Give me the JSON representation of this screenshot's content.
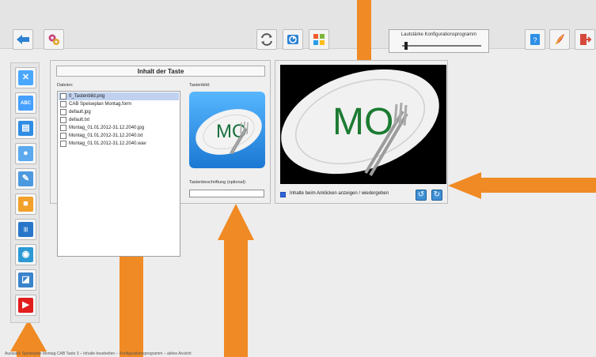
{
  "toolbar": {
    "volume_label": "Lautstärke Konfigurationsprogramm",
    "volume_level_fraction": 0.03,
    "icons": [
      "back-arrow-icon",
      "settings-gears-icon",
      "swap-icon",
      "window-icon",
      "windows-logo-icon",
      "help-icon",
      "feather-icon",
      "exit-icon"
    ]
  },
  "sidebar": {
    "items": [
      {
        "name": "tools",
        "color": "#4aa7ff",
        "glyph": "✕"
      },
      {
        "name": "abc",
        "color": "#46a0ff",
        "glyph": "ABC"
      },
      {
        "name": "gallery",
        "color": "#2f8de4",
        "glyph": "▤"
      },
      {
        "name": "microphone",
        "color": "#5ca9ef",
        "glyph": "●"
      },
      {
        "name": "document",
        "color": "#4c99df",
        "glyph": "✎"
      },
      {
        "name": "folder",
        "color": "#f2a12a",
        "glyph": "■"
      },
      {
        "name": "mixer",
        "color": "#2876c9",
        "glyph": "|||"
      },
      {
        "name": "globe",
        "color": "#2d9ad5",
        "glyph": "◉"
      },
      {
        "name": "drawing",
        "color": "#3a84cc",
        "glyph": "◪"
      },
      {
        "name": "video",
        "color": "#e21d1d",
        "glyph": "▶"
      }
    ]
  },
  "content": {
    "title": "Inhalt der Taste",
    "files_label": "Dateien:",
    "preview_label": "Tastenbild:",
    "preview_text": "MO",
    "caption_label": "Tastenbeschriftung (optional):",
    "caption_value": "",
    "files": [
      {
        "name": "0_Tastenbild.png",
        "selected": true
      },
      {
        "name": "CAB Speiseplan Montag.form",
        "selected": false
      },
      {
        "name": "default.jpg",
        "selected": false
      },
      {
        "name": "default.txt",
        "selected": false
      },
      {
        "name": "Montag_01.01.2012-31.12.2040.jpg",
        "selected": false
      },
      {
        "name": "Montag_01.01.2012-31.12.2040.txt",
        "selected": false
      },
      {
        "name": "Montag_01.01.2012-31.12.2040.wav",
        "selected": false
      }
    ]
  },
  "right_panel": {
    "big_preview_text": "MO",
    "checkbox_label": "Inhalte beim Anklicken anzeigen / wiedergeben",
    "checkbox_checked": true
  },
  "status": {
    "text": "Auswahl: Speiseplan Montag CAB Taste 3 – Inhalte bearbeiten – Konfigurationsprogramm – aktive Ansicht"
  },
  "colors": {
    "accent": "#3f8fd4",
    "preview_text": "#1c7b32",
    "arrow": "#f08a24"
  }
}
